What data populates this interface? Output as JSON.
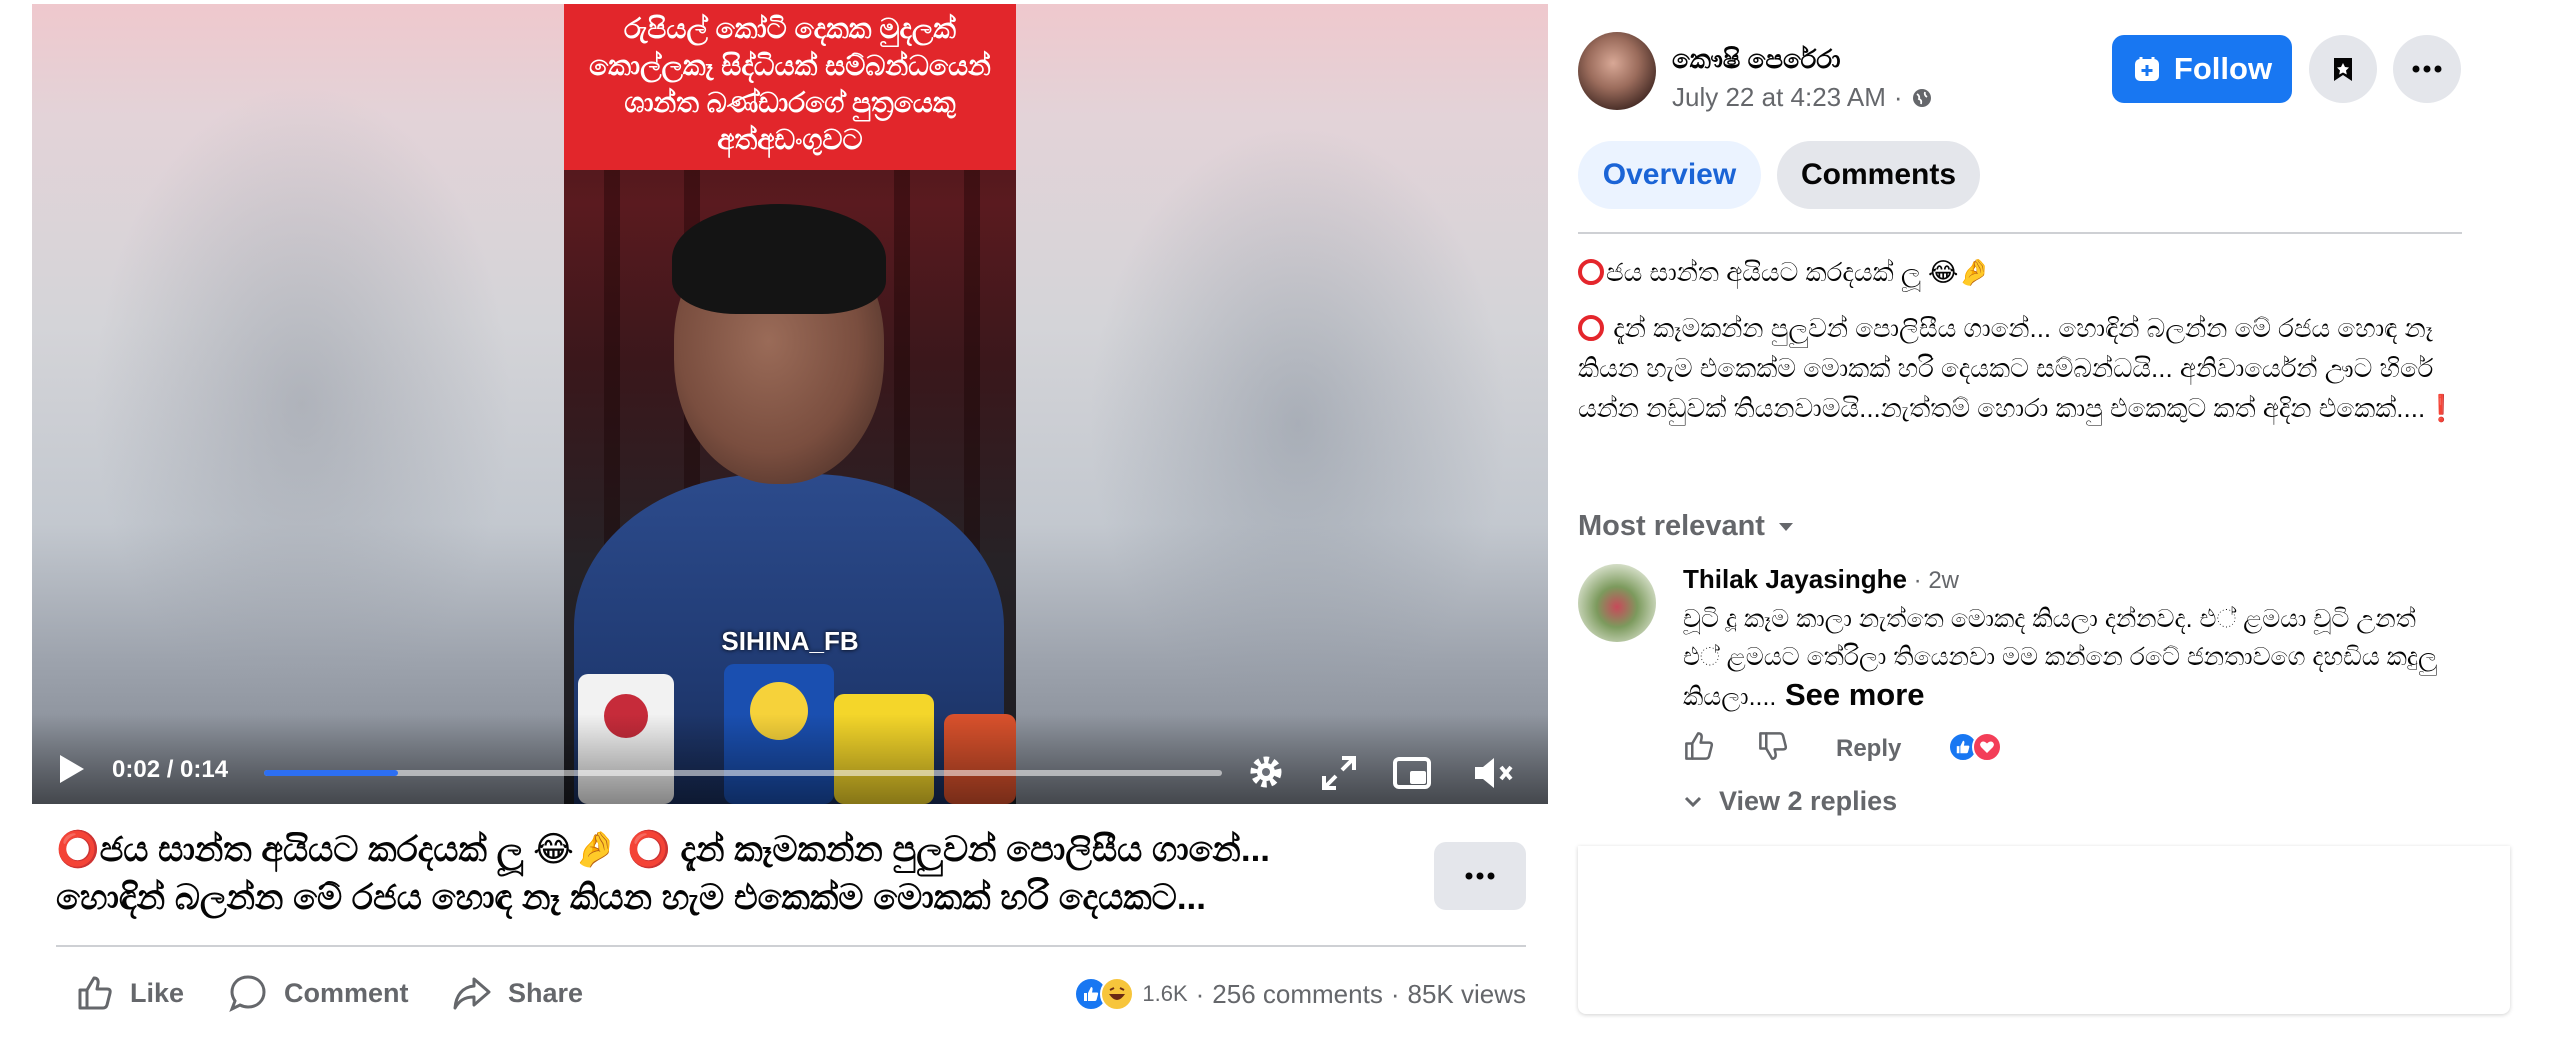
{
  "video": {
    "banner_lines": [
      "රුපියල් කෝටි දෙකක මුදලක්",
      "කොල්ලකෑ සිද්ධියක් සම්බන්ධයෙන්",
      "ශාන්ත බණ්ඩාරගේ පුත්‍රයෙකු",
      "අත්අඩංගුවට"
    ],
    "watermark": "SIHINA_FB",
    "time": "0:02 / 0:14",
    "progress_fraction": 0.14,
    "banner_color": "#e2262b",
    "icons": [
      "play-icon",
      "settings-icon",
      "fullscreen-icon",
      "pip-icon",
      "mute-icon"
    ]
  },
  "post": {
    "caption": "⭕ජය සාන්ත අයියට කරදයක් ලූ 😂🤌 ⭕ දැන් කෑමකන්න පුලුවන් පොලිසීය ගානේ... හොඳින් බලන්න මේ රජය හොඳ නෑ කියන හැම එකෙක්ම මොකක් හරි දෙයකට...",
    "actions": {
      "like": "Like",
      "comment": "Comment",
      "share": "Share"
    },
    "reaction_count": "1.6K",
    "comments_count": "256 comments",
    "views": "85K views",
    "separator": "·"
  },
  "author": {
    "name": "කෞෂි පෙරේරා",
    "time": "July 22 at 4:23 AM",
    "separator": "·",
    "follow_label": "Follow"
  },
  "tabs": [
    {
      "label": "Overview",
      "active": true
    },
    {
      "label": "Comments",
      "active": false
    }
  ],
  "description": {
    "title": "ජය සාන්ත අයියට කරදයක් ලූ 😂🤌",
    "body": " දැන් කෑමකන්න පුලුවන් පොලිසීය ගානේ... හොඳින් බලන්න මේ රජය හොඳ නෑ කියන හැම එකෙක්ම මොකක් හරි දෙයකට සම්බන්ධයි... අනිවාර්යෙන් ඌට හිරේ යන්න නඩුවක් තියනවාමයි...නැත්තම් හොරා කාපු එකෙකුට කත් අදින එකෙක්....",
    "end_mark": "❗"
  },
  "comments_section": {
    "sort_label": "Most relevant",
    "comment": {
      "author": "Thilak Jayasinghe",
      "age": " · 2w",
      "text": "චූටි දූ කෑම කාලා නැත්තෙ මොකද කියලා දන්නවද. එ් ළමයා චූටි උනත් එ් ළමයට තේරිලා තියෙනවා මම කන්නෙ රටේ ජනතාවගෙ දහඩිය කදුලු කියලා....",
      "see_more": " See more",
      "reply_label": "Reply"
    },
    "view_replies": "View 2 replies"
  },
  "colors": {
    "accent": "#1877f2",
    "secondary_text": "#65676b",
    "button_bg": "#e4e6eb",
    "tab_active_bg": "#ebf3ff",
    "tab_active_text": "#1b64d6"
  }
}
